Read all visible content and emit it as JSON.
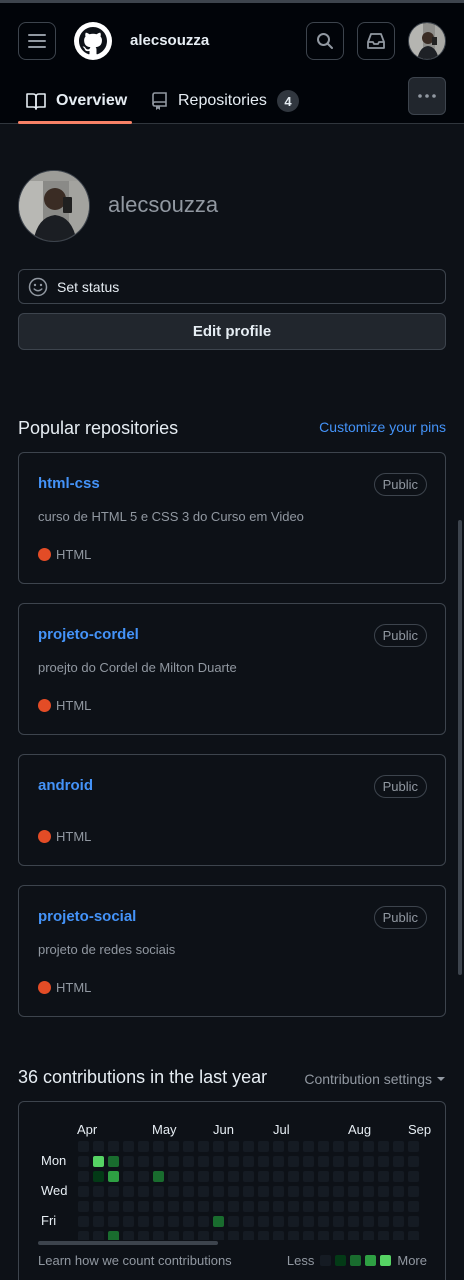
{
  "header": {
    "username": "alecsouzza",
    "tabs": [
      {
        "label": "Overview",
        "icon": "book-icon"
      },
      {
        "label": "Repositories",
        "icon": "repo-icon",
        "count": "4"
      }
    ]
  },
  "profile": {
    "name": "alecsouzza",
    "set_status": "Set status",
    "edit_profile": "Edit profile"
  },
  "popular": {
    "title": "Popular repositories",
    "customize": "Customize your pins",
    "repos": [
      {
        "name": "html-css",
        "visibility": "Public",
        "description": "curso de HTML 5 e CSS 3 do Curso em Video",
        "language": "HTML",
        "lang_color": "#e34c26"
      },
      {
        "name": "projeto-cordel",
        "visibility": "Public",
        "description": "proejto do Cordel de Milton Duarte",
        "language": "HTML",
        "lang_color": "#e34c26"
      },
      {
        "name": "android",
        "visibility": "Public",
        "description": "",
        "language": "HTML",
        "lang_color": "#e34c26"
      },
      {
        "name": "projeto-social",
        "visibility": "Public",
        "description": "projeto de redes sociais",
        "language": "HTML",
        "lang_color": "#e34c26"
      }
    ]
  },
  "contributions": {
    "title": "36 contributions in the last year",
    "settings": "Contribution settings",
    "months": [
      "Apr",
      "May",
      "Jun",
      "Jul",
      "Aug",
      "Sep"
    ],
    "days": [
      "Mon",
      "Wed",
      "Fri"
    ],
    "learn": "Learn how we count contributions",
    "less": "Less",
    "more": "More",
    "colors": {
      "empty": "#151b23",
      "l1": "#033a16",
      "l2": "#196c2e",
      "l3": "#2ea043",
      "l4": "#56d364"
    },
    "levels": [
      [
        0,
        0,
        0,
        0,
        0,
        0,
        0
      ],
      [
        0,
        4,
        1,
        0,
        0,
        0,
        0
      ],
      [
        0,
        2,
        3,
        0,
        0,
        0,
        2
      ],
      [
        0,
        0,
        0,
        0,
        0,
        0,
        0
      ],
      [
        0,
        0,
        0,
        0,
        0,
        0,
        0
      ],
      [
        0,
        0,
        2,
        0,
        0,
        0,
        0
      ],
      [
        0,
        0,
        0,
        0,
        0,
        0,
        0
      ],
      [
        0,
        0,
        0,
        0,
        0,
        0,
        0
      ],
      [
        0,
        0,
        0,
        0,
        0,
        0,
        0
      ],
      [
        0,
        0,
        0,
        0,
        0,
        2,
        0
      ],
      [
        0,
        0,
        0,
        0,
        0,
        0,
        0
      ],
      [
        0,
        0,
        0,
        0,
        0,
        0,
        0
      ],
      [
        0,
        0,
        0,
        0,
        0,
        0,
        0
      ],
      [
        0,
        0,
        0,
        0,
        0,
        0,
        0
      ],
      [
        0,
        0,
        0,
        0,
        0,
        0,
        0
      ],
      [
        0,
        0,
        0,
        0,
        0,
        0,
        0
      ],
      [
        0,
        0,
        0,
        0,
        0,
        0,
        0
      ],
      [
        0,
        0,
        0,
        0,
        0,
        0,
        0
      ],
      [
        0,
        0,
        0,
        0,
        0,
        0,
        0
      ],
      [
        0,
        0,
        0,
        0,
        0,
        0,
        0
      ],
      [
        0,
        0,
        0,
        0,
        0,
        0,
        0
      ],
      [
        0,
        0,
        0,
        0,
        0,
        0,
        0
      ],
      [
        0,
        0,
        0,
        0,
        0,
        0,
        0
      ]
    ]
  }
}
